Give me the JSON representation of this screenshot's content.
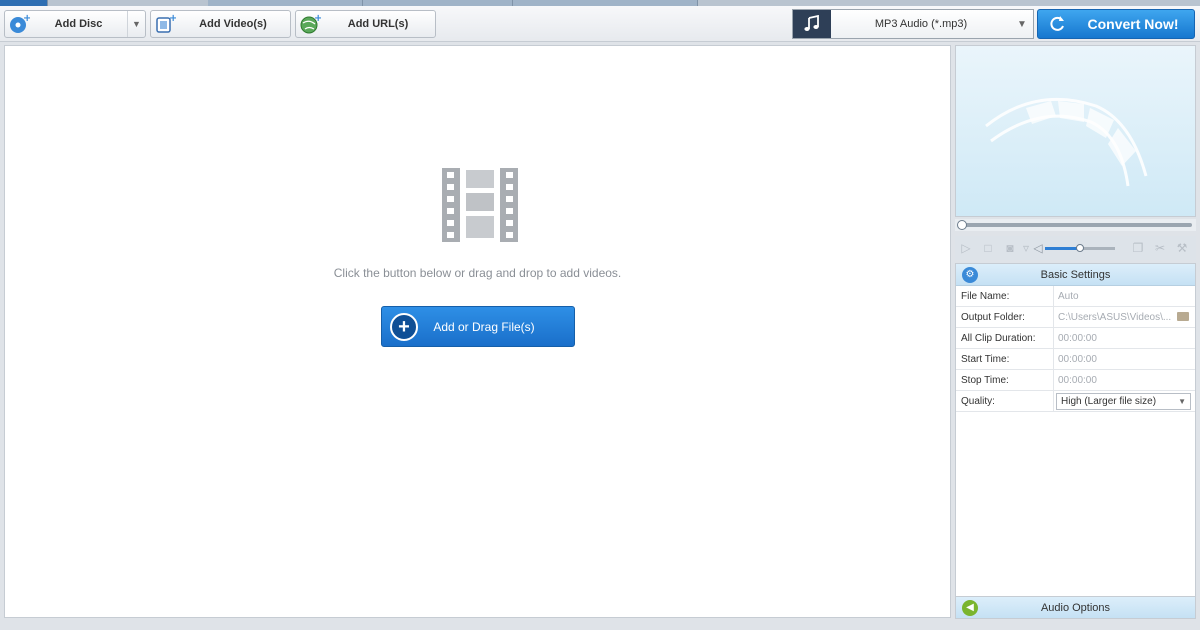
{
  "toolbar": {
    "add_disc": "Add Disc",
    "add_videos": "Add Video(s)",
    "add_url": "Add URL(s)",
    "format_selected": "MP3 Audio (*.mp3)",
    "convert": "Convert Now!"
  },
  "main": {
    "hint": "Click the button below or drag and drop to add videos.",
    "add_drag_label": "Add or Drag File(s)"
  },
  "basic_settings": {
    "title": "Basic Settings",
    "rows": [
      {
        "key": "File Name:",
        "value": "Auto"
      },
      {
        "key": "Output Folder:",
        "value": "C:\\Users\\ASUS\\Videos\\..."
      },
      {
        "key": "All Clip Duration:",
        "value": "00:00:00"
      },
      {
        "key": "Start Time:",
        "value": "00:00:00"
      },
      {
        "key": "Stop Time:",
        "value": "00:00:00"
      },
      {
        "key": "Quality:",
        "value": "High (Larger file size)"
      }
    ]
  },
  "audio_options": {
    "title": "Audio Options"
  },
  "colors": {
    "accent": "#1a6fca",
    "convert": "#1677cf",
    "format_icon_bg": "#2e3f57"
  }
}
